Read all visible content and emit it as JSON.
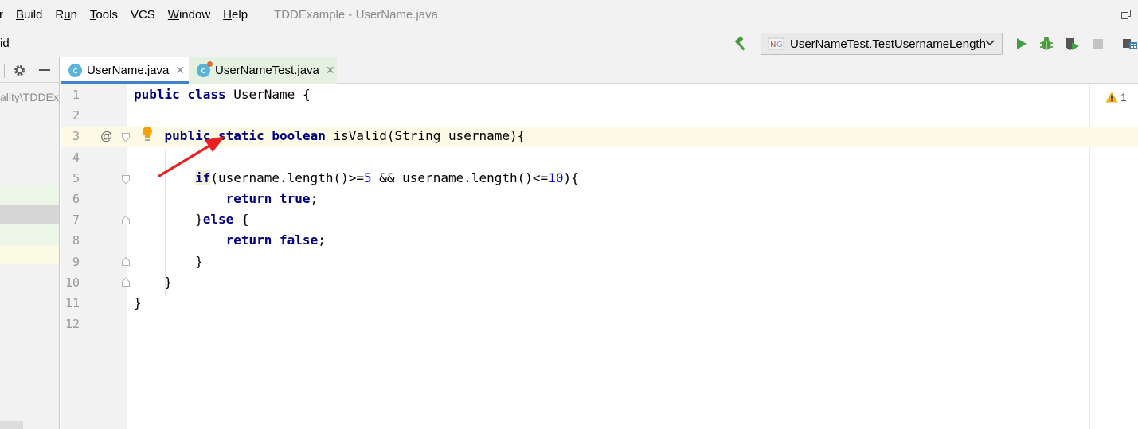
{
  "menu": {
    "items": [
      {
        "pre": "",
        "u": "",
        "post": "r"
      },
      {
        "pre": "",
        "u": "B",
        "post": "uild"
      },
      {
        "pre": "R",
        "u": "u",
        "post": "n"
      },
      {
        "pre": "",
        "u": "T",
        "post": "ools"
      },
      {
        "pre": "VC",
        "u": "",
        "post": "S"
      },
      {
        "pre": "",
        "u": "W",
        "post": "indow"
      },
      {
        "pre": "",
        "u": "H",
        "post": "elp"
      }
    ],
    "window_title": "TDDExample - UserName.java"
  },
  "toolbar": {
    "breadcrumb_tail": "id",
    "run_config": "UserNameTest.TestUsernameLength",
    "icons": [
      "hammer-icon",
      "run-icon",
      "debug-icon",
      "coverage-icon",
      "stop-icon",
      "project-structure-icon"
    ]
  },
  "left_panel": {
    "path_text": "ality\\TDDExample"
  },
  "tabs": [
    {
      "label": "UserName.java",
      "icon": "class-icon",
      "active": true
    },
    {
      "label": "UserNameTest.java",
      "icon": "test-class-icon",
      "active": false
    }
  ],
  "editor": {
    "line_numbers": [
      "1",
      "2",
      "3",
      "4",
      "5",
      "6",
      "7",
      "8",
      "9",
      "10",
      "11",
      "12"
    ],
    "current_line": 3,
    "warnings_count": "1",
    "lines": [
      [
        {
          "t": "public",
          "c": "kw"
        },
        {
          "t": " "
        },
        {
          "t": "class",
          "c": "kw"
        },
        {
          "t": " UserName {"
        }
      ],
      [],
      [
        {
          "t": "    "
        },
        {
          "t": "public",
          "c": "kw"
        },
        {
          "t": " "
        },
        {
          "t": "static",
          "c": "kw"
        },
        {
          "t": " "
        },
        {
          "t": "boolean",
          "c": "kw"
        },
        {
          "t": " isValid(String username){"
        }
      ],
      [],
      [
        {
          "t": "        "
        },
        {
          "t": "if",
          "c": "kw if-hl"
        },
        {
          "t": "(username.length()>="
        },
        {
          "t": "5",
          "c": "num"
        },
        {
          "t": " && username.length()<="
        },
        {
          "t": "10",
          "c": "num"
        },
        {
          "t": "){"
        }
      ],
      [
        {
          "t": "            "
        },
        {
          "t": "return",
          "c": "kw"
        },
        {
          "t": " "
        },
        {
          "t": "true",
          "c": "kw"
        },
        {
          "t": ";"
        }
      ],
      [
        {
          "t": "        }"
        },
        {
          "t": "else",
          "c": "kw"
        },
        {
          "t": " {"
        }
      ],
      [
        {
          "t": "            "
        },
        {
          "t": "return",
          "c": "kw"
        },
        {
          "t": " "
        },
        {
          "t": "false",
          "c": "kw"
        },
        {
          "t": ";"
        }
      ],
      [
        {
          "t": "        }"
        }
      ],
      [
        {
          "t": "    }"
        }
      ],
      [
        {
          "t": "}"
        }
      ],
      []
    ]
  },
  "colors": {
    "keyword": "#000080",
    "number": "#0000ff",
    "current_line_bg": "#fdfae5",
    "annotation_arrow": "#e8201f",
    "tab_underline": "#4083c9"
  }
}
